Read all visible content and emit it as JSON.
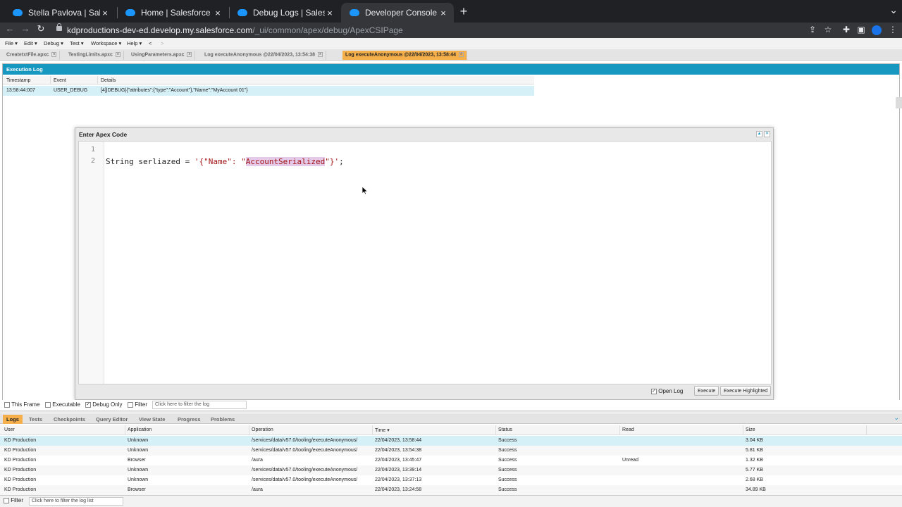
{
  "browser": {
    "tabs": [
      {
        "title": "Stella Pavlova | Salesforce",
        "close": "×"
      },
      {
        "title": "Home | Salesforce",
        "close": "×"
      },
      {
        "title": "Debug Logs | Salesforce",
        "close": "×"
      },
      {
        "title": "Developer Console",
        "close": "×"
      }
    ],
    "new_tab": "+",
    "url_host": "kdproductions-dev-ed.develop.my.salesforce.com",
    "url_path": "/_ui/common/apex/debug/ApexCSIPage"
  },
  "console": {
    "menu": [
      "File ▾",
      "Edit ▾",
      "Debug ▾",
      "Test ▾",
      "Workspace ▾",
      "Help ▾",
      "<",
      ">"
    ],
    "file_tabs": [
      "CreatetxtFile.apxc",
      "TestingLimits.apxc",
      "UsingParameters.apxc",
      "Log executeAnonymous @22/04/2023, 13:54:38",
      "Log executeAnonymous @22/04/2023, 13:58:44"
    ],
    "execution_log": {
      "title": "Execution Log",
      "columns": [
        "Timestamp",
        "Event",
        "Details"
      ],
      "rows": [
        {
          "timestamp": "13:58:44:007",
          "event": "USER_DEBUG",
          "details": "[4]|DEBUG|{\"attributes\":{\"type\":\"Account\"},\"Name\":\"MyAccount 01\"}"
        }
      ]
    },
    "apex_dialog": {
      "title": "Enter Apex Code",
      "line_numbers": [
        "1",
        "2"
      ],
      "code": {
        "prefix": "String serliazed = ",
        "str_open": "'{\"Name\": \"",
        "highlight": "AccountSerialized",
        "str_close": "\"}'",
        "suffix": ";"
      },
      "open_log_label": "Open Log",
      "execute_label": "Execute",
      "execute_highlighted_label": "Execute Highlighted"
    },
    "filters": {
      "this_frame": "This Frame",
      "executable": "Executable",
      "debug_only": "Debug Only",
      "filter": "Filter",
      "filter_placeholder": "Click here to filter the log"
    },
    "bottom_tabs": [
      "Logs",
      "Tests",
      "Checkpoints",
      "Query Editor",
      "View State",
      "Progress",
      "Problems"
    ],
    "logs_table": {
      "columns": [
        "User",
        "Application",
        "Operation",
        "Time ▾",
        "Status",
        "Read",
        "Size"
      ],
      "rows": [
        {
          "user": "KD Production",
          "application": "Unknown",
          "operation": "/services/data/v57.0/tooling/executeAnonymous/",
          "time": "22/04/2023, 13:58:44",
          "status": "Success",
          "read": "",
          "size": "3.04 KB"
        },
        {
          "user": "KD Production",
          "application": "Unknown",
          "operation": "/services/data/v57.0/tooling/executeAnonymous/",
          "time": "22/04/2023, 13:54:38",
          "status": "Success",
          "read": "",
          "size": "5.81 KB"
        },
        {
          "user": "KD Production",
          "application": "Browser",
          "operation": "/aura",
          "time": "22/04/2023, 13:45:47",
          "status": "Success",
          "read": "Unread",
          "size": "1.32 KB"
        },
        {
          "user": "KD Production",
          "application": "Unknown",
          "operation": "/services/data/v57.0/tooling/executeAnonymous/",
          "time": "22/04/2023, 13:39:14",
          "status": "Success",
          "read": "",
          "size": "5.77 KB"
        },
        {
          "user": "KD Production",
          "application": "Unknown",
          "operation": "/services/data/v57.0/tooling/executeAnonymous/",
          "time": "22/04/2023, 13:37:13",
          "status": "Success",
          "read": "",
          "size": "2.68 KB"
        },
        {
          "user": "KD Production",
          "application": "Browser",
          "operation": "/aura",
          "time": "22/04/2023, 13:24:58",
          "status": "Success",
          "read": "",
          "size": "34.89 KB"
        }
      ]
    },
    "log_filter": {
      "label": "Filter",
      "placeholder": "Click here to filter the log list"
    }
  }
}
